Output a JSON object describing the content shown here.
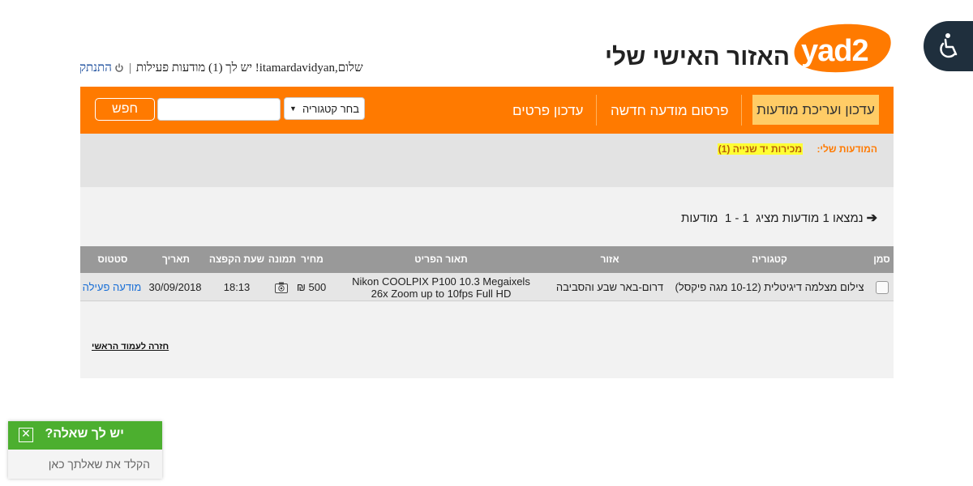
{
  "header": {
    "logo_text": "yad2",
    "page_heading": "האזור האישי שלי",
    "greeting_prefix": "שלום,",
    "username": "itamardavidyan",
    "greeting_suffix": "! יש לך (1) מודעות פעילות",
    "separator": "|",
    "logout_label": "התנתק"
  },
  "nav": {
    "items": [
      {
        "label": "עדכון ועריכת מודעות",
        "active": true
      },
      {
        "label": "פרסום מודעה חדשה",
        "active": false
      },
      {
        "label": "עדכון פרטים",
        "active": false
      }
    ],
    "category_select": "בחר קטגוריה",
    "search_button": "חפש"
  },
  "my_ads": {
    "label": "המודעות שלי:",
    "link": "מכירות יד שנייה (1)"
  },
  "results": {
    "found_text": "נמצאו 1 מודעות מציג  1 - 1  מודעות"
  },
  "table": {
    "headers": {
      "select": "סמן",
      "category": "קטגוריה",
      "area": "אזור",
      "description": "תאור הפריט",
      "price": "מחיר",
      "image": "תמונה",
      "bump_time": "שעת הקפצה",
      "date": "תאריך",
      "status": "סטטוס"
    },
    "rows": [
      {
        "category": "צילום מצלמה דיגיטלית (10-12 מגה פיקסל)",
        "area": "דרום-באר שבע והסביבה",
        "description_line1": "Nikon COOLPIX P100 10.3 Megaixels",
        "description_line2": "26x Zoom up to 10fps Full HD",
        "price": "500 ₪",
        "image_icon": "camera-icon",
        "bump_time": "18:13",
        "date": "30/09/2018",
        "status": "מודעה פעילה"
      }
    ],
    "back_link": "חזרה לעמוד הראשי"
  },
  "chat": {
    "title": "יש לך שאלה?",
    "placeholder": "הקלד את שאלתך כאן",
    "close_icon": "close-icon"
  },
  "colors": {
    "brand_orange": "#ff7a00",
    "active_tab": "#ffcc66",
    "chat_green": "#4caf2f",
    "link_blue": "#1a6fd6"
  }
}
